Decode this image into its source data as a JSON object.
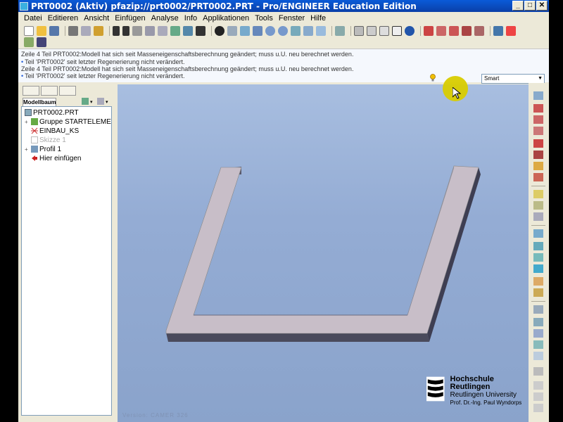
{
  "window": {
    "title": "PRT0002 (Aktiv) pfazip://prt0002/PRT0002.PRT - Pro/ENGINEER Education Edition",
    "min_glyph": "_",
    "max_glyph": "□",
    "close_glyph": "✕"
  },
  "menu": [
    "Datei",
    "Editieren",
    "Ansicht",
    "Einfügen",
    "Analyse",
    "Info",
    "Applikationen",
    "Tools",
    "Fenster",
    "Hilfe"
  ],
  "messages": [
    {
      "text": "Zeile 4 Teil PRT0002:Modell hat sich seit Masseneigenschaftsberechnung geändert; muss u.U. neu berechnet werden.",
      "bullet": false
    },
    {
      "text": "Teil 'PRT0002' seit letzter Regenerierung nicht verändert.",
      "bullet": true
    },
    {
      "text": "Zeile 4 Teil PRT0002:Modell hat sich seit Masseneigenschaftsberechnung geändert; muss u.U. neu berechnet werden.",
      "bullet": false
    },
    {
      "text": "Teil 'PRT0002' seit letzter Regenerierung nicht verändert.",
      "bullet": true
    }
  ],
  "filter": {
    "value": "Smart"
  },
  "navigator": {
    "tab_label": "Modellbaum",
    "items": [
      {
        "label": "PRT0002.PRT",
        "icon": "part-icon",
        "dim": false,
        "expand": ""
      },
      {
        "label": "Gruppe STARTELEMENT",
        "icon": "group-icon",
        "dim": false,
        "expand": "+"
      },
      {
        "label": "EINBAU_KS",
        "icon": "csys-icon",
        "dim": false,
        "expand": ""
      },
      {
        "label": "Skizze 1",
        "icon": "sketch-icon",
        "dim": true,
        "expand": ""
      },
      {
        "label": "Profil 1",
        "icon": "protrusion-icon",
        "dim": false,
        "expand": "+"
      },
      {
        "label": "Hier einfügen",
        "icon": "insert-here-icon",
        "dim": false,
        "expand": ""
      }
    ]
  },
  "logo": {
    "line1": "Hochschule Reutlingen",
    "line2": "Reutlingen University",
    "line3": "Prof. Dr.-Ing. Paul Wyndorps"
  },
  "viewport_footer": "Version: CAMER 326",
  "colors": {
    "title_bar": "#0a4fc8",
    "viewport_bg": "#94acd4",
    "model_top": "#c8bec8",
    "model_side": "#4a4a5c",
    "cursor_highlight": "#d8cc00"
  }
}
